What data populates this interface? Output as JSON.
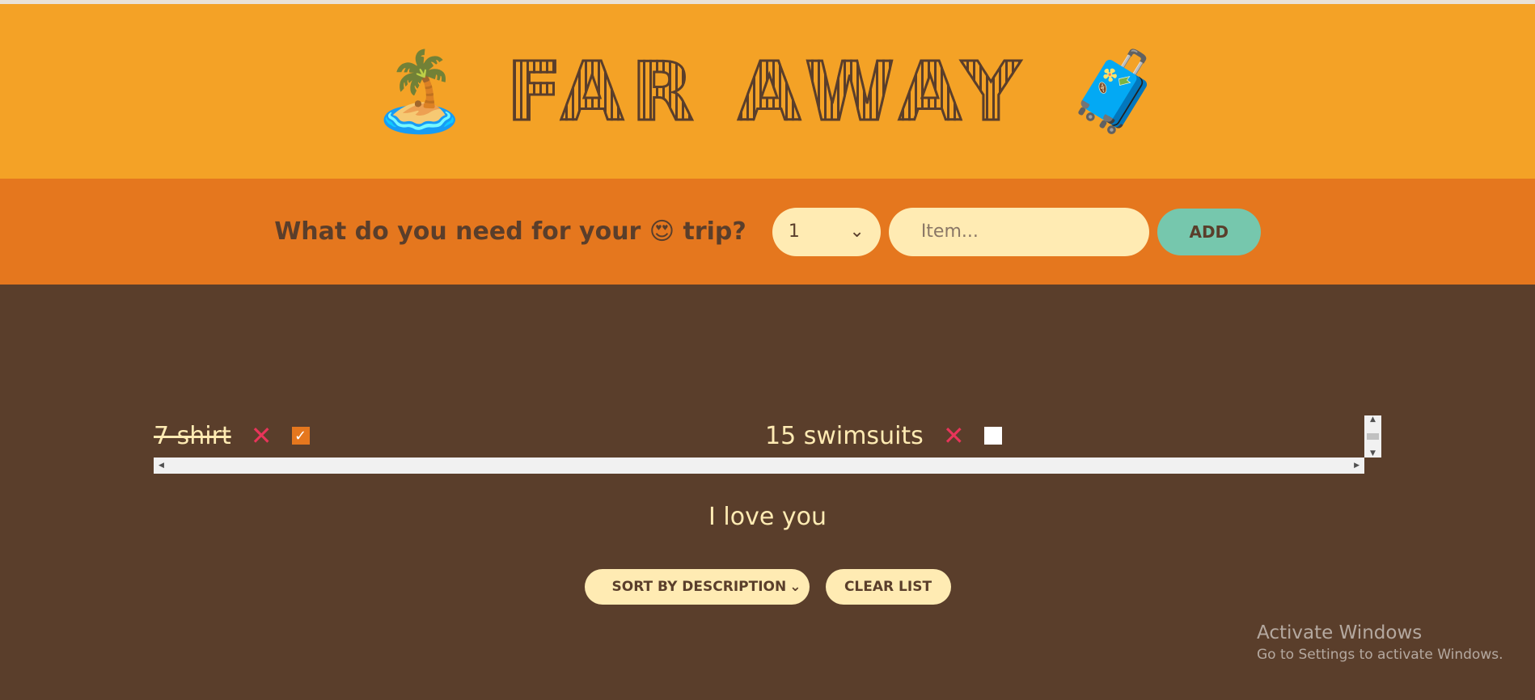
{
  "header": {
    "left_icon": "palm-tree-icon",
    "left_emoji": "🏝️",
    "title": "FAR AWAY",
    "right_icon": "suitcase-icon",
    "right_emoji": "🧳"
  },
  "form": {
    "question": "What do you need for your 😍 trip?",
    "quantity_value": "1",
    "item_placeholder": "Item...",
    "add_label": "ADD"
  },
  "items": [
    {
      "text": "7 shirt",
      "packed": true,
      "delete_symbol": "✕",
      "check_symbol": "✓"
    },
    {
      "text": "15 swimsuits",
      "packed": false,
      "delete_symbol": "✕",
      "check_symbol": ""
    }
  ],
  "stats": {
    "text": "I love you"
  },
  "actions": {
    "sort_value": "SORT BY DESCRIPTION",
    "clear_label": "CLEAR LIST"
  },
  "watermark": {
    "title": "Activate Windows",
    "subtitle": "Go to Settings to activate Windows."
  },
  "colors": {
    "header_bg": "#f4a226",
    "form_bg": "#e5771e",
    "body_bg": "#5a3e2b",
    "add_button": "#76c7ad",
    "delete": "#e8345a",
    "cream": "#ffebb3"
  }
}
